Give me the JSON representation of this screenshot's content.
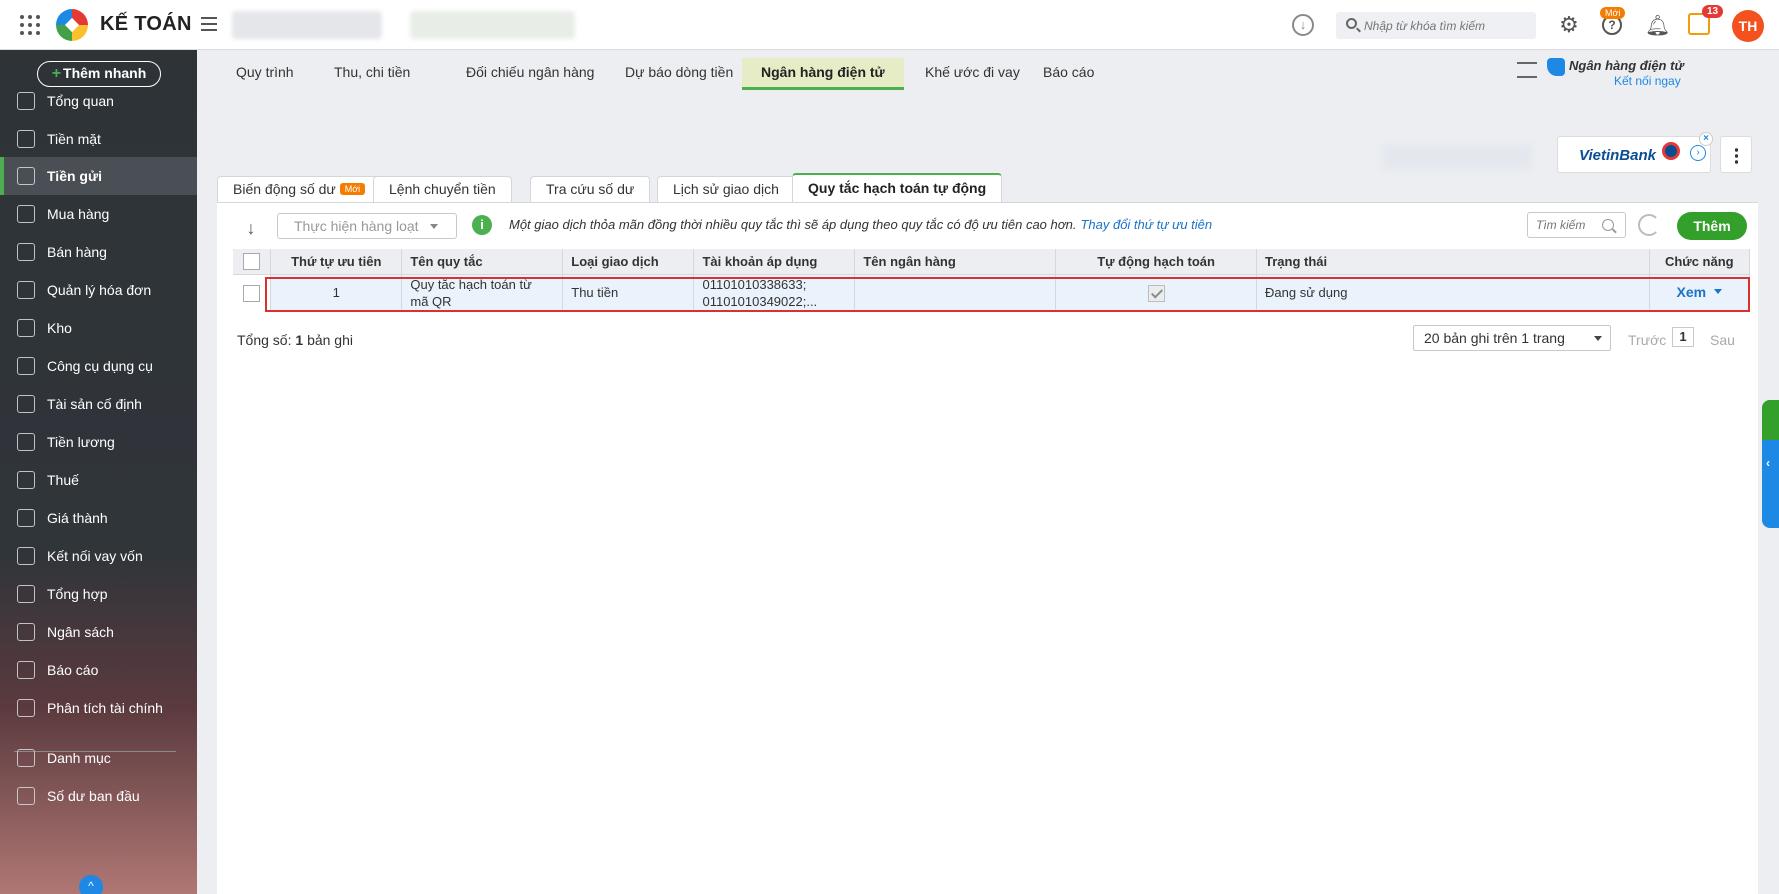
{
  "app": {
    "title": "KẾ TOÁN"
  },
  "header": {
    "search_placeholder": "Nhập từ khóa tìm kiếm",
    "badge_new": "Mới",
    "notification_count": "13",
    "avatar_initials": "TH"
  },
  "sidebar": {
    "quick_add": "Thêm nhanh",
    "items": [
      {
        "label": "Tổng quan",
        "icon": "pie-chart-icon"
      },
      {
        "label": "Tiền mặt",
        "icon": "money-bag-icon"
      },
      {
        "label": "Tiền gửi",
        "icon": "bank-chart-icon",
        "active": true
      },
      {
        "label": "Mua hàng",
        "icon": "shopping-bag-icon"
      },
      {
        "label": "Bán hàng",
        "icon": "cart-icon"
      },
      {
        "label": "Quản lý hóa đơn",
        "icon": "invoice-icon"
      },
      {
        "label": "Kho",
        "icon": "warehouse-icon"
      },
      {
        "label": "Công cụ dụng cụ",
        "icon": "tools-icon"
      },
      {
        "label": "Tài sản cố định",
        "icon": "car-icon"
      },
      {
        "label": "Tiền lương",
        "icon": "salary-icon"
      },
      {
        "label": "Thuế",
        "icon": "tax-icon"
      },
      {
        "label": "Giá thành",
        "icon": "price-tag-icon"
      },
      {
        "label": "Kết nối vay vốn",
        "icon": "loan-icon"
      },
      {
        "label": "Tổng hợp",
        "icon": "summary-icon"
      },
      {
        "label": "Ngân sách",
        "icon": "budget-icon"
      },
      {
        "label": "Báo cáo",
        "icon": "report-icon"
      },
      {
        "label": "Phân tích tài chính",
        "icon": "analytics-icon"
      },
      {
        "label": "Danh mục",
        "icon": "list-icon"
      },
      {
        "label": "Số dư ban đầu",
        "icon": "balance-icon"
      }
    ]
  },
  "main_tabs": [
    {
      "label": "Quy trình"
    },
    {
      "label": "Thu, chi tiền"
    },
    {
      "label": "Đối chiếu ngân hàng"
    },
    {
      "label": "Dự báo dòng tiền"
    },
    {
      "label": "Ngân hàng điện tử",
      "active": true
    },
    {
      "label": "Khế ước đi vay"
    },
    {
      "label": "Báo cáo"
    }
  ],
  "ebank": {
    "title": "Ngân hàng điện tử",
    "link": "Kết nối ngay",
    "bank_name": "VietinBank"
  },
  "sub_tabs": [
    {
      "label": "Biến động số dư",
      "badge": "Mới"
    },
    {
      "label": "Lệnh chuyển tiền"
    },
    {
      "label": "Tra cứu số dư"
    },
    {
      "label": "Lịch sử giao dịch"
    },
    {
      "label": "Quy tắc hạch toán tự động",
      "active": true
    }
  ],
  "toolbar": {
    "bulk_action": "Thực hiện hàng loạt",
    "info_text": "Một giao dịch thỏa mãn đồng thời nhiều quy tắc thì sẽ áp dụng theo quy tắc có độ ưu tiên cao hơn.",
    "info_link": "Thay đổi thứ tự ưu tiên",
    "search_placeholder": "Tìm kiếm",
    "add_label": "Thêm"
  },
  "table": {
    "columns": [
      "Thứ tự ưu tiên",
      "Tên quy tắc",
      "Loại giao dịch",
      "Tài khoản áp dụng",
      "Tên ngân hàng",
      "Tự động hạch toán",
      "Trạng thái",
      "Chức năng"
    ],
    "rows": [
      {
        "priority": "1",
        "rule_name_line1": "Quy tắc hạch toán từ",
        "rule_name_line2": "mã QR",
        "transaction_type": "Thu tiền",
        "account_line1": "01101010338633;",
        "account_line2": "01101010349022;...",
        "bank_name": "",
        "auto_posting": true,
        "status": "Đang sử dụng",
        "action": "Xem"
      }
    ]
  },
  "footer": {
    "total_label": "Tổng số:",
    "total_count": "1",
    "total_suffix": "bản ghi",
    "page_size": "20 bản ghi trên 1 trang",
    "prev": "Trước",
    "page": "1",
    "next": "Sau"
  }
}
